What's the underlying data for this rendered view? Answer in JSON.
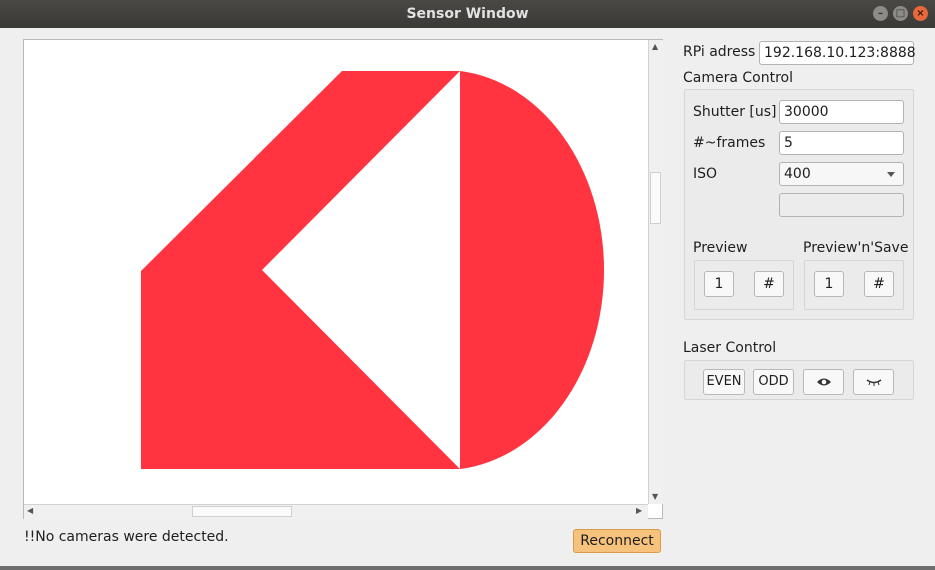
{
  "window": {
    "title": "Sensor Window"
  },
  "status": {
    "message": "!!No cameras were detected."
  },
  "buttons": {
    "reconnect": "Reconnect"
  },
  "connection": {
    "rpi_label": "RPi adress",
    "rpi_value": "192.168.10.123:8888"
  },
  "camera": {
    "section_title": "Camera Control",
    "shutter_label": "Shutter [us]",
    "shutter_value": "30000",
    "frames_label": "#~frames",
    "frames_value": "5",
    "iso_label": "ISO",
    "iso_value": "400",
    "extra_value": "",
    "preview_label": "Preview",
    "preview_one": "1",
    "preview_hash": "#",
    "preview_save_label": "Preview'n'Save",
    "preview_save_one": "1",
    "preview_save_hash": "#"
  },
  "laser": {
    "section_title": "Laser Control",
    "even": "EVEN",
    "odd": "ODD",
    "on_icon": "eye-icon",
    "off_icon": "closed-eye-icon"
  },
  "colors": {
    "logo_red": "#ff3440",
    "reconnect_bg": "#f6c27c"
  }
}
